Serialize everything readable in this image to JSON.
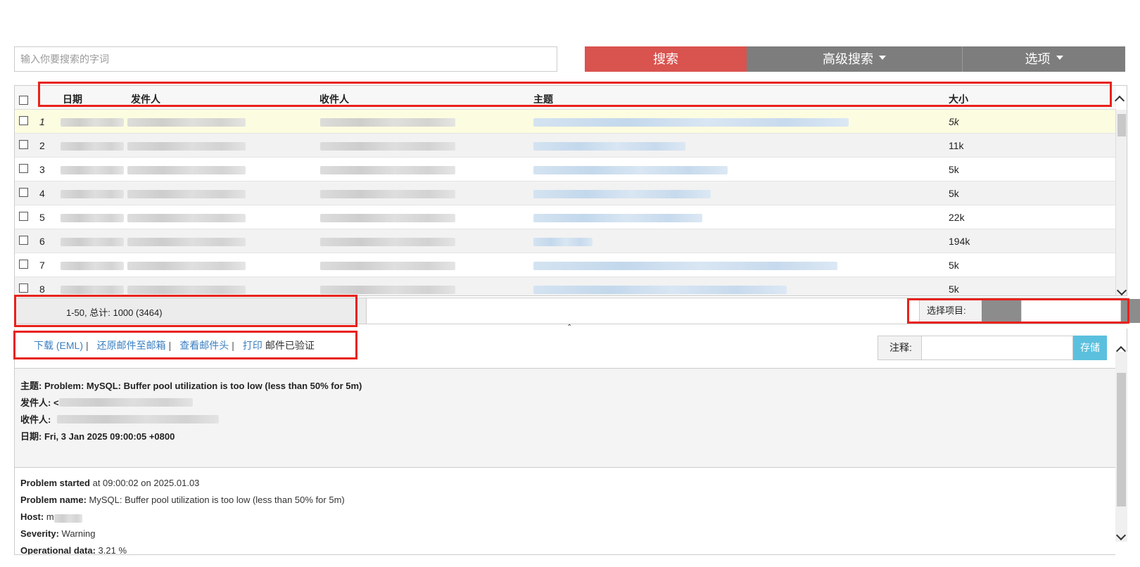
{
  "search": {
    "placeholder": "输入你要搜索的字词",
    "search_label": "搜索",
    "advanced_label": "高级搜索",
    "options_label": "选项"
  },
  "colors": {
    "search_button": "#d9534f",
    "gray_button": "#7d7d7d",
    "save_button": "#5bc0de",
    "link": "#3a7fc1",
    "annotation": "#e8221b"
  },
  "table": {
    "headers": {
      "date": "日期",
      "from": "发件人",
      "to": "收件人",
      "subject": "主题",
      "size": "大小"
    },
    "rows": [
      {
        "num": "1",
        "size": "5k"
      },
      {
        "num": "2",
        "size": "11k"
      },
      {
        "num": "3",
        "size": "5k"
      },
      {
        "num": "4",
        "size": "5k"
      },
      {
        "num": "5",
        "size": "22k"
      },
      {
        "num": "6",
        "size": "194k"
      },
      {
        "num": "7",
        "size": "5k"
      },
      {
        "num": "8",
        "size": "5k"
      }
    ]
  },
  "pager": {
    "info": "1-50, 总计: 1000 (3464)",
    "select_label": "选择项目:"
  },
  "message_toolbar": {
    "download": "下载 (EML)",
    "restore": "还原邮件至邮箱",
    "view_headers": "查看邮件头",
    "print": "打印",
    "verified": "邮件已验证",
    "sep": "|",
    "note_label": "注释:",
    "save": "存储"
  },
  "message": {
    "subject": "主题: Problem: MySQL: Buffer pool utilization is too low (less than 50% for 5m)",
    "from_label": "发件人: <",
    "to_label": "收件人:",
    "date": "日期: Fri, 3 Jan 2025 09:00:05 +0800",
    "body": {
      "started_label": "Problem started",
      "started_value": " at 09:00:02 on 2025.01.03",
      "name_label": "Problem name:",
      "name_value": " MySQL: Buffer pool utilization is too low (less than 50% for 5m)",
      "host_label": "Host:",
      "host_value": " m",
      "severity_label": "Severity:",
      "severity_value": " Warning",
      "opdata_label": "Operational data:",
      "opdata_value": " 3.21 %"
    }
  }
}
